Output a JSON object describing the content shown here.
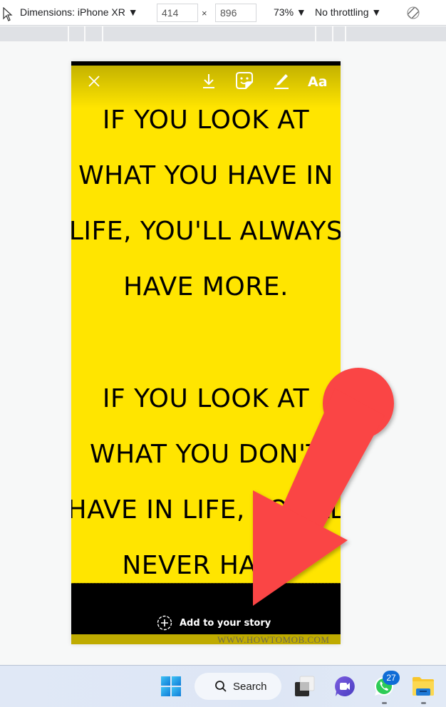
{
  "devtools_toolbar": {
    "dimensions_label": "Dimensions: iPhone XR ▼",
    "width_value": "414",
    "times": "×",
    "height_value": "896",
    "zoom_label": "73% ▼",
    "throttling_label": "No throttling ▼"
  },
  "story": {
    "tools": {
      "text_tool_label": "Aa"
    },
    "quote_lines": [
      "IF YOU LOOK AT",
      "WHAT YOU HAVE IN",
      "LIFE, YOU'LL ALWAYS",
      "HAVE MORE.",
      "IF YOU LOOK AT",
      "WHAT YOU DON'T",
      "HAVE IN LIFE, YOU'LL",
      "NEVER HAVE"
    ],
    "add_to_story_label": "Add to your story",
    "watermark": "WWW.HOWTOMOB.COM",
    "background_color": "#ffe500"
  },
  "annotation": {
    "arrow_color": "#fa4444"
  },
  "taskbar": {
    "search_label": "Search",
    "whatsapp_badge": "27"
  }
}
